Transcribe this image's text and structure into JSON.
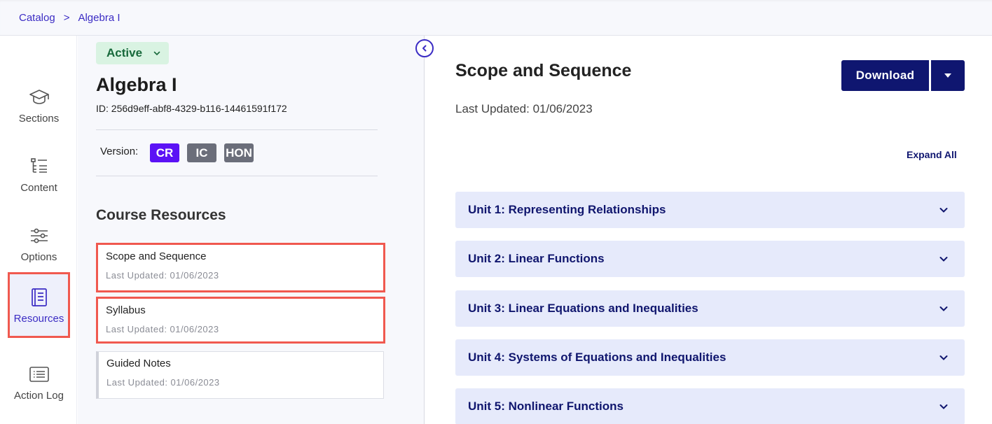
{
  "breadcrumb": {
    "items": [
      "Catalog",
      "Algebra I"
    ],
    "separator": ">"
  },
  "rail": {
    "items": [
      {
        "label": "Sections",
        "icon": "graduation-cap-icon"
      },
      {
        "label": "Content",
        "icon": "tree-list-icon"
      },
      {
        "label": "Options",
        "icon": "sliders-icon"
      },
      {
        "label": "Resources",
        "icon": "book-icon",
        "active": true
      },
      {
        "label": "Action Log",
        "icon": "log-list-icon"
      }
    ]
  },
  "course": {
    "status": "Active",
    "title": "Algebra I",
    "id": "ID: 256d9eff-abf8-4329-b116-14461591f172",
    "version_label": "Version:",
    "versions": [
      {
        "label": "CR",
        "color": "#5b12f5"
      },
      {
        "label": "IC",
        "color": "#6b6e7a"
      },
      {
        "label": "HON",
        "color": "#6b6e7a"
      }
    ]
  },
  "resources": {
    "heading": "Course Resources",
    "items": [
      {
        "title": "Scope and Sequence",
        "updated": "Last Updated: 01/06/2023"
      },
      {
        "title": "Syllabus",
        "updated": "Last Updated: 01/06/2023"
      },
      {
        "title": "Guided Notes",
        "updated": "Last Updated: 01/06/2023"
      }
    ]
  },
  "detail": {
    "title": "Scope and Sequence",
    "updated": "Last Updated: 01/06/2023",
    "download_label": "Download",
    "expand_all": "Expand All",
    "units": [
      "Unit 1: Representing Relationships",
      "Unit 2: Linear Functions",
      "Unit 3: Linear Equations and Inequalities",
      "Unit 4: Systems of Equations and Inequalities",
      "Unit 5: Nonlinear Functions"
    ]
  },
  "colors": {
    "accent": "#3b2cc4",
    "navy": "#0f1670",
    "highlight": "#f0594f",
    "status_bg": "#d9f3e2",
    "unit_bg": "#e6eafb"
  }
}
